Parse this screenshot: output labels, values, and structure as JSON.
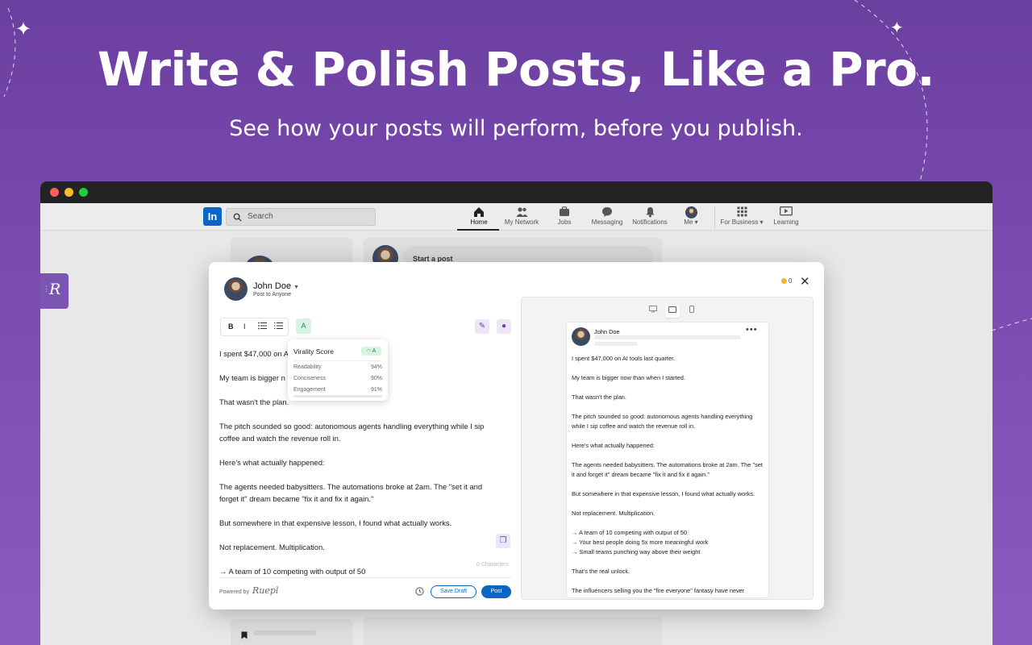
{
  "hero": {
    "title": "Write & Polish Posts, Like a Pro.",
    "subtitle": "See how your posts will perform, before you publish."
  },
  "linkedin": {
    "logo": "In",
    "search_placeholder": "Search",
    "nav": [
      {
        "label": "Home",
        "icon": "home-icon"
      },
      {
        "label": "My Network",
        "icon": "network-icon"
      },
      {
        "label": "Jobs",
        "icon": "briefcase-icon"
      },
      {
        "label": "Messaging",
        "icon": "message-icon"
      },
      {
        "label": "Notifications",
        "icon": "bell-icon"
      },
      {
        "label": "Me ▾",
        "icon": "avatar"
      },
      {
        "label": "For Business ▾",
        "icon": "grid-icon"
      },
      {
        "label": "Learning",
        "icon": "play-icon"
      }
    ],
    "start_post": "Start a post"
  },
  "composer": {
    "author_name": "John Doe",
    "audience": "Post to Anyone",
    "coins": "0",
    "toolbar": {
      "bold": "B",
      "italic": "I",
      "grade": "A"
    },
    "virality": {
      "title": "Virality Score",
      "grade": "A",
      "rows": [
        {
          "label": "Readability",
          "value": "94%"
        },
        {
          "label": "Conciseness",
          "value": "90%"
        },
        {
          "label": "Engagement",
          "value": "91%"
        }
      ]
    },
    "lines": [
      "I spent $47,000 on A",
      "My team is bigger n",
      "That wasn't the plan.",
      "The pitch sounded so good: autonomous agents handling everything while I sip coffee and watch the revenue roll in.",
      "Here's what actually happened:",
      "The agents needed babysitters. The automations broke at 2am. The \"set it and forget it\" dream became \"fix it and fix it again.\"",
      "But somewhere in that expensive lesson, I found what actually works.",
      "Not replacement. Multiplication.",
      "→ A team of 10 competing with output of 50"
    ],
    "char_count": "0 Characters",
    "powered_by": "Powered by",
    "brand": "Ruepl",
    "save_draft": "Save Draft",
    "post": "Post"
  },
  "preview": {
    "author_name": "John Doe",
    "paragraphs": [
      "I spent $47,000 on AI tools last quarter.",
      "",
      "My team is bigger now than when I started.",
      "",
      "That wasn't the plan.",
      "",
      "The pitch sounded so good: autonomous agents handling everything while I sip coffee and watch the revenue roll in.",
      "",
      "Here's what actually happened:",
      "",
      "The agents needed babysitters. The automations broke at 2am. The \"set it and forget it\" dream became \"fix it and fix it again.\"",
      "",
      "But somewhere in that expensive lesson, I found what actually works.",
      "",
      "Not replacement. Multiplication.",
      "",
      "→ A team of 10 competing with output of 50",
      "→ Your best people doing 5x more meaningful work",
      "→ Small teams punching way above their weight",
      "",
      "That's the real unlock.",
      "",
      "The influencers selling you the \"fire everyone\" fantasy have never operated a business past the demo stage."
    ]
  },
  "colors": {
    "background": "#7a4ab0",
    "linkedin_blue": "#0a66c2",
    "grade_green": "#1e8a4d",
    "accent_purple": "#6c3fb0"
  }
}
